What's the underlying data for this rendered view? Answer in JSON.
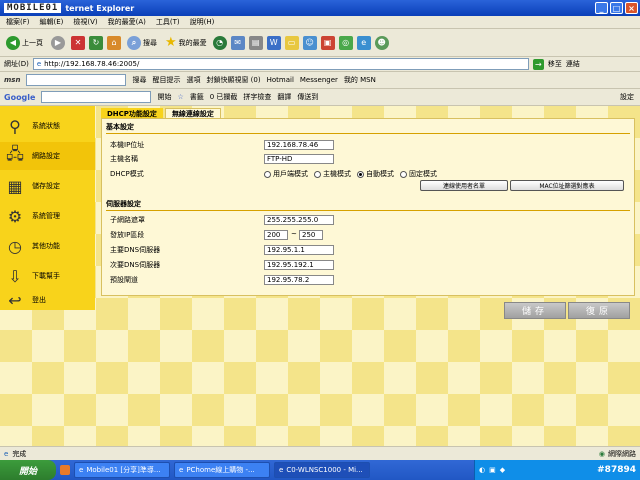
{
  "window": {
    "title_logo": "MOBILE01",
    "title": "ternet Explorer",
    "minimize": "_",
    "maximize": "□",
    "close": "×"
  },
  "menu": [
    "檔案(F)",
    "編輯(E)",
    "檢視(V)",
    "我的最愛(A)",
    "工具(T)",
    "說明(H)"
  ],
  "toolbar": {
    "back": "上一頁",
    "search": "搜尋",
    "favorites": "我的最愛"
  },
  "address": {
    "label": "網址(D)",
    "url": "http://192.168.78.46:2005/",
    "go": "移至",
    "links": "連結"
  },
  "msnbar": {
    "brand": "msn",
    "search": "搜尋",
    "highlight": "醒目提示",
    "options": "選項",
    "popup": "封鎖快顯視窗 (0)",
    "hotmail": "Hotmail",
    "messenger": "Messenger",
    "mymsn": "我的 MSN"
  },
  "googlebar": {
    "brand": "Google",
    "start": "開始",
    "bookmarks": "書籤",
    "blocked": "0 已攔截",
    "spell": "拼字檢查",
    "translate": "翻譯",
    "send": "傳送到",
    "settings": "設定"
  },
  "sidebar": [
    {
      "label": "系統狀態",
      "icon": "magnifier-icon"
    },
    {
      "label": "網路設定",
      "icon": "network-icon"
    },
    {
      "label": "儲存設定",
      "icon": "storage-icon"
    },
    {
      "label": "系統管理",
      "icon": "gear-icon"
    },
    {
      "label": "其他功能",
      "icon": "clock-icon"
    },
    {
      "label": "下載幫手",
      "icon": "download-icon"
    },
    {
      "label": "登出",
      "icon": "logout-icon"
    }
  ],
  "tabs": [
    "DHCP功能設定",
    "無線連線設定"
  ],
  "basic": {
    "heading": "基本設定",
    "ip_label": "本機IP位址",
    "ip": "192.168.78.46",
    "host_label": "主機名稱",
    "host": "FTP-HD",
    "dhcp_label": "DHCP模式",
    "modes": [
      "用戶端模式",
      "主機模式",
      "自動模式",
      "固定模式"
    ],
    "selected_mode": "自動模式",
    "btn_clients": "連線使用者名單",
    "btn_mac": "MAC位址篩選對應表"
  },
  "server": {
    "heading": "伺服器設定",
    "mask_label": "子網路遮罩",
    "mask": "255.255.255.0",
    "range_label": "發放IP區段",
    "range_start": "200",
    "range_sep": "~",
    "range_end": "250",
    "dns1_label": "主要DNS伺服器",
    "dns1": "192.95.1.1",
    "dns2_label": "次要DNS伺服器",
    "dns2": "192.95.192.1",
    "gw_label": "預設閘道",
    "gw": "192.95.78.2"
  },
  "actions": {
    "save": "儲存",
    "reset": "復原"
  },
  "status": {
    "left": "完成",
    "zone": "網際網路"
  },
  "taskbar": {
    "start": "開始",
    "tasks": [
      "Mobile01 [分享]準導...",
      "PChome線上購物 -...",
      "C0-WLNSC1000 - Mi..."
    ],
    "watermark": "#87894"
  }
}
